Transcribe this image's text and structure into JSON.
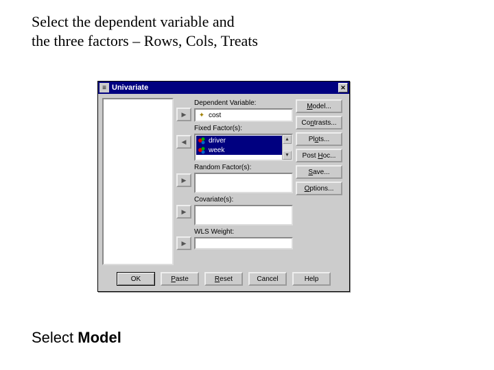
{
  "instructions": {
    "top_line1": "Select the dependent variable and",
    "top_line2": "the three factors – Rows, Cols, Treats",
    "bottom_prefix": "Select ",
    "bottom_bold": "Model"
  },
  "dialog": {
    "title": "Univariate",
    "labels": {
      "dependent": "Dependent Variable:",
      "fixed": "Fixed Factor(s):",
      "random": "Random Factor(s):",
      "covariates": "Covariate(s):",
      "wls": "WLS Weight:"
    },
    "dependent_value": "cost",
    "fixed_factors": [
      "driver",
      "week"
    ],
    "side_buttons": {
      "model": "Model...",
      "contrasts": "Contrasts...",
      "plots": "Plots...",
      "posthoc": "Post Hoc...",
      "save": "Save...",
      "options": "Options..."
    },
    "bottom_buttons": {
      "ok": "OK",
      "paste": "Paste",
      "reset": "Reset",
      "cancel": "Cancel",
      "help": "Help"
    }
  }
}
